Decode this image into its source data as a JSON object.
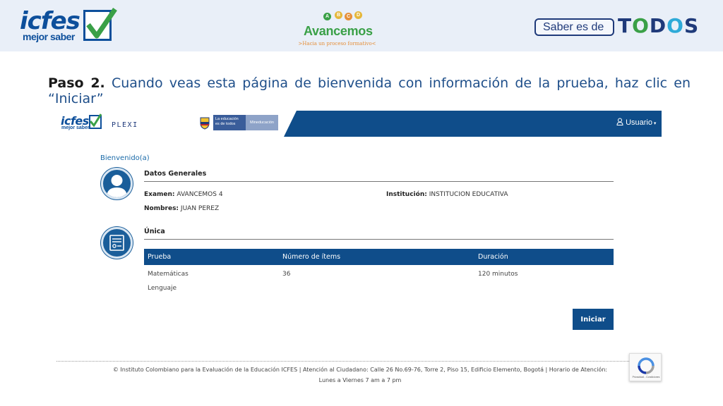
{
  "banner": {
    "icfes_logo": {
      "word": "icfes",
      "subtitle": "mejor saber"
    },
    "avancemos_logo": {
      "word": "Avancemos",
      "tagline": ">Hacia un proceso formativo<",
      "balls": [
        "A",
        "B",
        "C",
        "D"
      ]
    },
    "saber_logo": {
      "prefix": "Saber es de",
      "word_parts": [
        "T",
        "O",
        "D",
        "O",
        "S"
      ]
    }
  },
  "instruction": {
    "step": "Paso 2.",
    "text": " Cuando veas esta página de bienvenida con información de la prueba, haz clic en “Iniciar”"
  },
  "app": {
    "header": {
      "icfes_word": "icfes",
      "icfes_sub": "mejor saber",
      "plexi": "PLEXI",
      "gov_a": "La educación es de todos",
      "gov_b": "Mineducación",
      "user_menu": "Usuario"
    },
    "welcome": "Bienvenido(a)",
    "general": {
      "title": "Datos Generales",
      "exam_label": "Examen:",
      "exam_value": "AVANCEMOS 4",
      "institution_label": "Institución:",
      "institution_value": "INSTITUCION EDUCATIVA",
      "names_label": "Nombres:",
      "names_value": "JUAN PEREZ"
    },
    "single": {
      "title": "Única",
      "columns": [
        "Prueba",
        "Número de ítems",
        "Duración"
      ],
      "rows": [
        {
          "prueba": "Matemáticas",
          "items": "36",
          "duracion": "120 minutos"
        },
        {
          "prueba": "Lenguaje",
          "items": "",
          "duracion": ""
        }
      ]
    },
    "start_button": "Iniciar",
    "footer": "© Instituto Colombiano para la Evaluación de la Educación ICFES | Atención al Ciudadano: Calle 26 No.69-76, Torre 2, Piso 15, Edificio Elemento, Bogotá | Horario de Atención: Lunes a Viernes 7 am a 7 pm",
    "recaptcha_label": "Privacidad - Condiciones"
  },
  "colors": {
    "primary_blue": "#0f4d8a",
    "logo_blue": "#0d4f9b",
    "accent_green": "#3aa047",
    "banner_bg": "#e9eff8"
  }
}
